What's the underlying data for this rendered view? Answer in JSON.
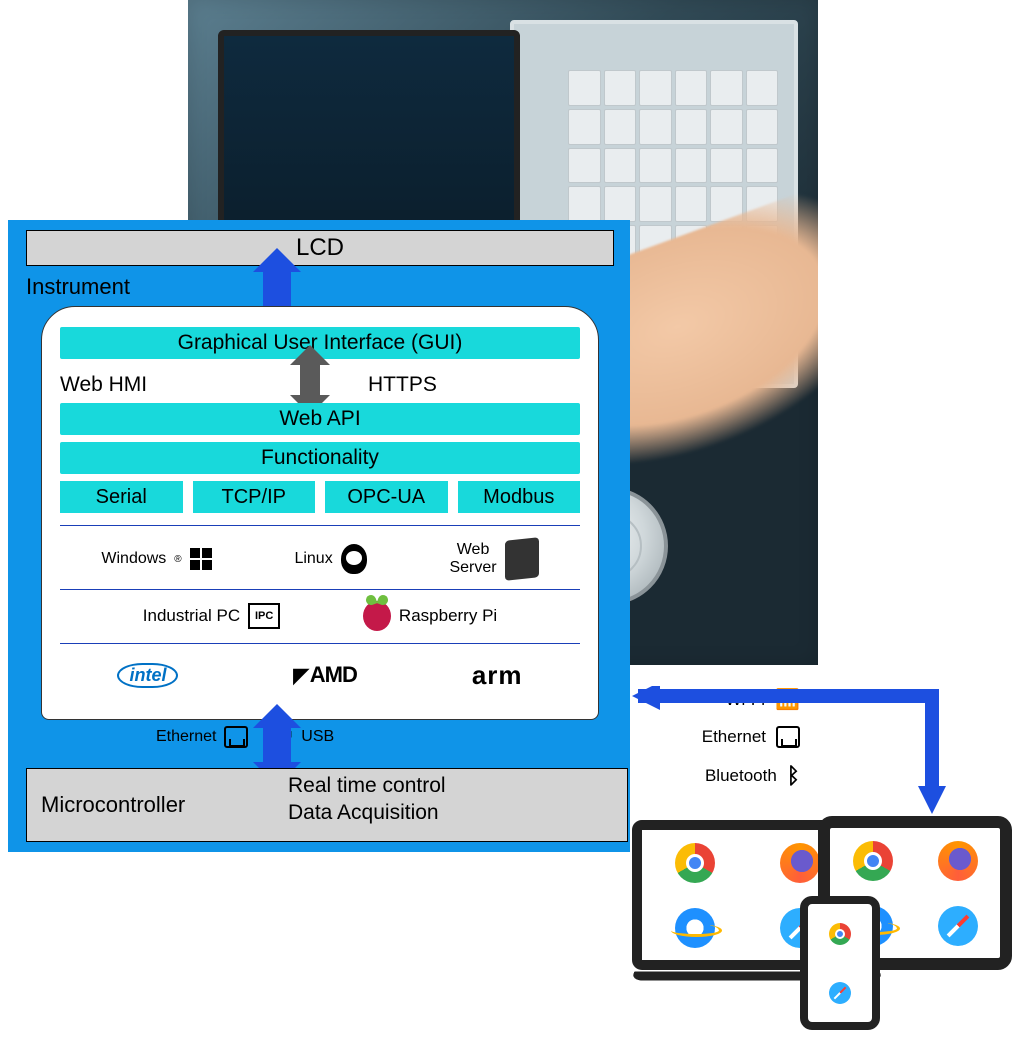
{
  "panel": {
    "lcd": "LCD",
    "instrument": "Instrument",
    "gui": "Graphical User Interface (GUI)",
    "webhmi": "Web HMI",
    "https": "HTTPS",
    "webapi": "Web API",
    "functionality": "Functionality",
    "protocols": [
      "Serial",
      "TCP/IP",
      "OPC-UA",
      "Modbus"
    ],
    "os": {
      "windows": "Windows",
      "reg": "®",
      "linux": "Linux",
      "webserver": "Web\nServer"
    },
    "hw": {
      "ipc": "Industrial PC",
      "ipc_badge": "IPC",
      "rpi": "Raspberry Pi"
    },
    "chips": {
      "intel": "intel",
      "amd": "AMD",
      "arm": "arm"
    },
    "links": {
      "ethernet": "Ethernet",
      "usb": "USB"
    },
    "mc": {
      "title": "Microcontroller",
      "line1": "Real time control",
      "line2": "Data Acquisition"
    }
  },
  "wireless": {
    "wifi": "Wi-Fi",
    "ethernet": "Ethernet",
    "bluetooth": "Bluetooth"
  },
  "browsers": [
    "chrome",
    "firefox",
    "ie",
    "safari"
  ]
}
